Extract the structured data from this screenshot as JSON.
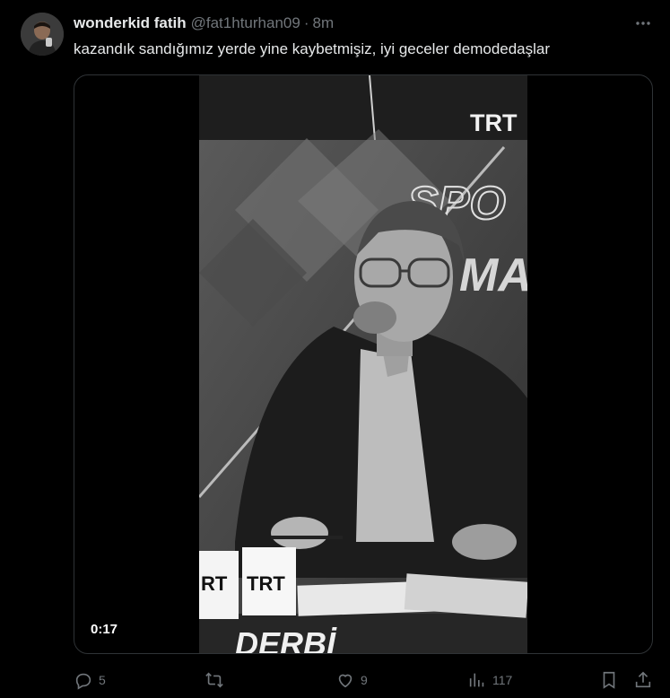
{
  "tweet": {
    "display_name": "wonderkid fatih",
    "handle": "@fat1hturhan09",
    "separator": "·",
    "time": "8m",
    "text": "kazandık sandığımız yerde yine kaybetmişiz, iyi geceler demodedaşlar"
  },
  "media": {
    "duration": "0:17",
    "brand_text_top": "TRT",
    "desk_sign_left": "RT",
    "desk_sign_right": "TRT",
    "bottom_text": "DERBİ",
    "backdrop_text_1": "SPO",
    "backdrop_text_2": "MA"
  },
  "actions": {
    "replies": "5",
    "reposts": "",
    "likes": "9",
    "views": "117"
  },
  "colors": {
    "background": "#000000",
    "text_primary": "#e7e9ea",
    "text_secondary": "#71767b",
    "border": "#2f3336"
  },
  "icons": {
    "more": "more-icon",
    "reply": "reply-icon",
    "repost": "repost-icon",
    "like": "like-icon",
    "views": "views-icon",
    "bookmark": "bookmark-icon",
    "share": "share-icon"
  }
}
